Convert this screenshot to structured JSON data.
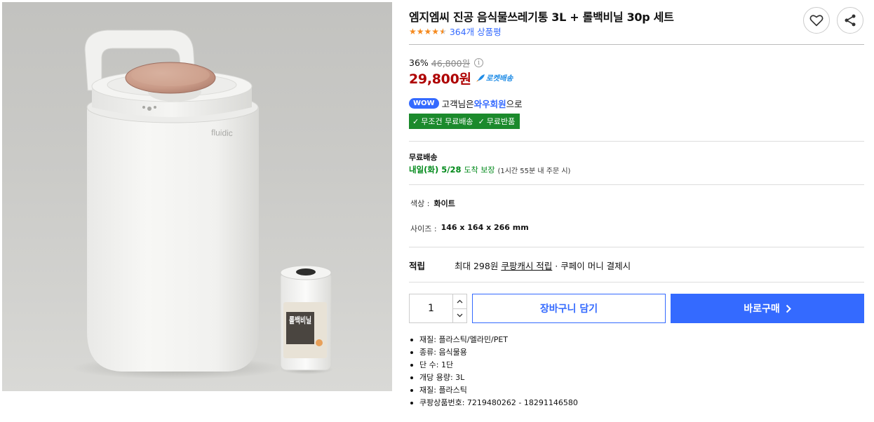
{
  "product": {
    "title": "엠지엠씨 진공 음식물쓰레기통 3L + 롤백비닐 30p 세트",
    "rating_stars": 4.5,
    "review_count_text": "364개 상품평",
    "image_brand": "fluidic",
    "image_roll_label": "롤백비닐"
  },
  "price": {
    "discount_rate": "36%",
    "original_price": "46,800원",
    "info_glyph": "i",
    "sale_price": "29,800원",
    "rocket_label": "로켓배송"
  },
  "membership": {
    "badge": "WOW",
    "text_prefix": "고객님은 ",
    "link_text": "와우회원",
    "text_suffix": "으로",
    "benefit_1": "무조건 무료배송",
    "benefit_2": "무료반품"
  },
  "shipping": {
    "label": "무료배송",
    "date": "내일(화) 5/28",
    "guarantee": "도착 보장",
    "note": "(1시간 55분 내 주문 시)"
  },
  "options": [
    {
      "key": "색상 :",
      "value": "화이트"
    },
    {
      "key": "사이즈 :",
      "value": "146 x 164 x 266 mm"
    }
  ],
  "points": {
    "label": "적립",
    "text_prefix": "최대 298원 ",
    "link": "쿠팡캐시 적립",
    "text_suffix": " · 쿠페이 머니 결제시"
  },
  "purchase": {
    "quantity": "1",
    "cart_label": "장바구니 담기",
    "buy_label": "바로구매"
  },
  "specs": [
    "재질: 플라스틱/멜라민/PET",
    "종류: 음식물용",
    "단 수: 1단",
    "개당 용량: 3L",
    "재질: 플라스틱",
    "쿠팡상품번호: 7219480262 - 18291146580"
  ],
  "colors": {
    "accent": "#346aff",
    "price_red": "#ae0000",
    "green": "#1b8a2c",
    "star": "#f58a1f"
  }
}
